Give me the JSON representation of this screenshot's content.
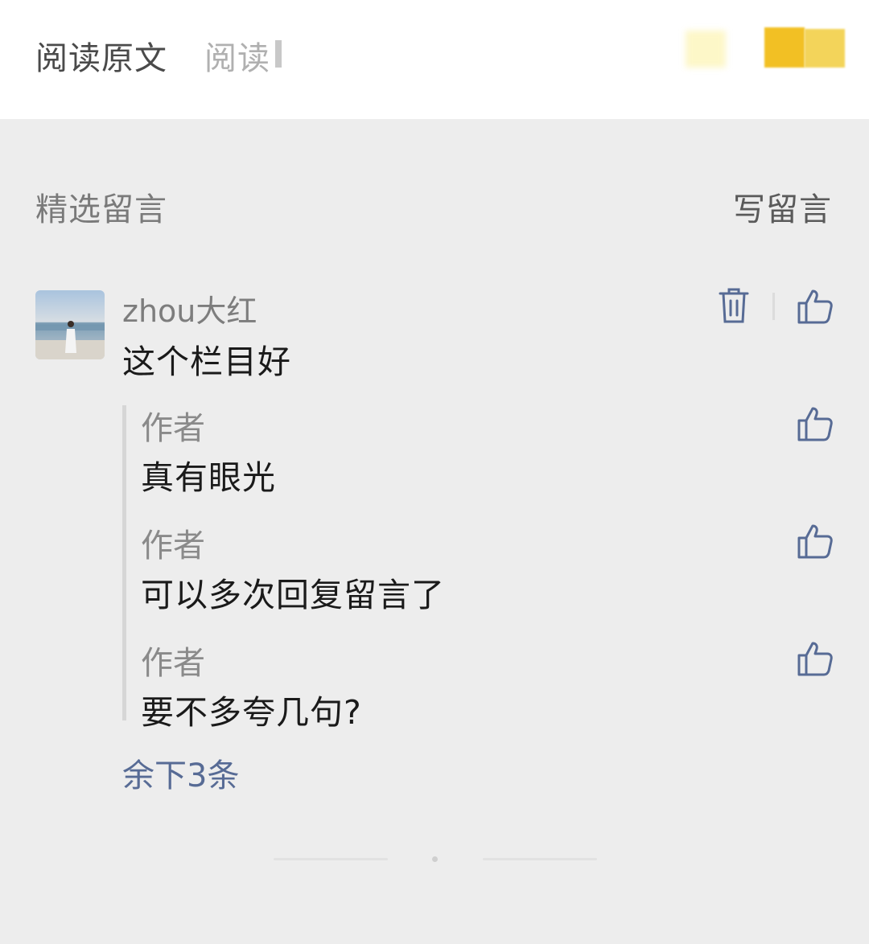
{
  "topbar": {
    "read_original": "阅读原文",
    "read_count_label": "阅读"
  },
  "comments_section": {
    "title": "精选留言",
    "write_label": "写留言"
  },
  "comment": {
    "author": "zhou大红",
    "text": "这个栏目好",
    "replies": [
      {
        "author": "作者",
        "text": "真有眼光"
      },
      {
        "author": "作者",
        "text": "可以多次回复留言了"
      },
      {
        "author": "作者",
        "text": "要不多夸几句?"
      }
    ],
    "more_replies": "余下3条"
  },
  "colors": {
    "link": "#576b95",
    "background": "#ededed",
    "icon": "#576b95"
  },
  "icons": [
    "trash-icon",
    "thumbs-up-icon"
  ]
}
